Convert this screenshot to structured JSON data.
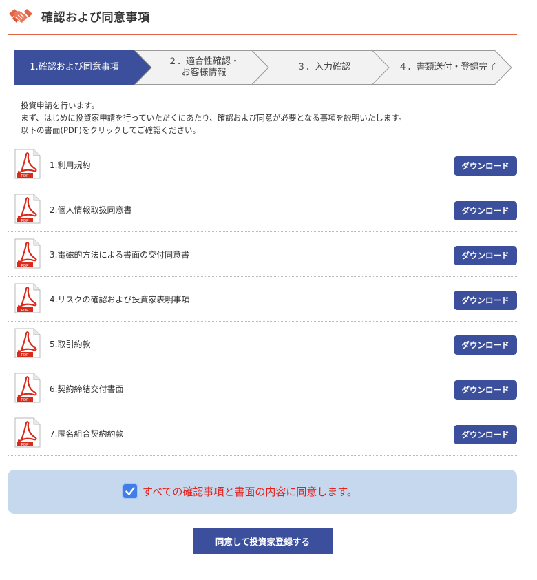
{
  "header": {
    "title": "確認および同意事項",
    "icon": "handshake-icon"
  },
  "steps": [
    {
      "label": "1.確認および同意事項",
      "active": true
    },
    {
      "label": "２．適合性確認・\nお客様情報",
      "active": false
    },
    {
      "label": "３．入力確認",
      "active": false
    },
    {
      "label": "４．書類送付・登録完了",
      "active": false
    }
  ],
  "intro": {
    "line1": "投資申請を行います。",
    "line2": "まず、はじめに投資家申請を行っていただくにあたり、確認および同意が必要となる事項を説明いたします。",
    "line3": "以下の書面(PDF)をクリックしてご確認ください。"
  },
  "documents": [
    {
      "label": "1.利用規約",
      "button": "ダウンロード"
    },
    {
      "label": "2.個人情報取扱同意書",
      "button": "ダウンロード"
    },
    {
      "label": "3.電磁的方法による書面の交付同意書",
      "button": "ダウンロード"
    },
    {
      "label": "4.リスクの確認および投資家表明事項",
      "button": "ダウンロード"
    },
    {
      "label": "5.取引約款",
      "button": "ダウンロード"
    },
    {
      "label": "6.契約締結交付書面",
      "button": "ダウンロード"
    },
    {
      "label": "7.匿名組合契約約款",
      "button": "ダウンロード"
    }
  ],
  "pdf_icon_text": "PDF",
  "agree": {
    "checked": true,
    "text": "すべての確認事項と書面の内容に同意します。"
  },
  "submit": {
    "label": "同意して投資家登録する"
  },
  "colors": {
    "accent": "#3b4f9c",
    "header_rule": "#e06446",
    "agree_bg": "#c5d8ed",
    "agree_text": "#e5211c",
    "checkbox": "#3f7ee8"
  }
}
